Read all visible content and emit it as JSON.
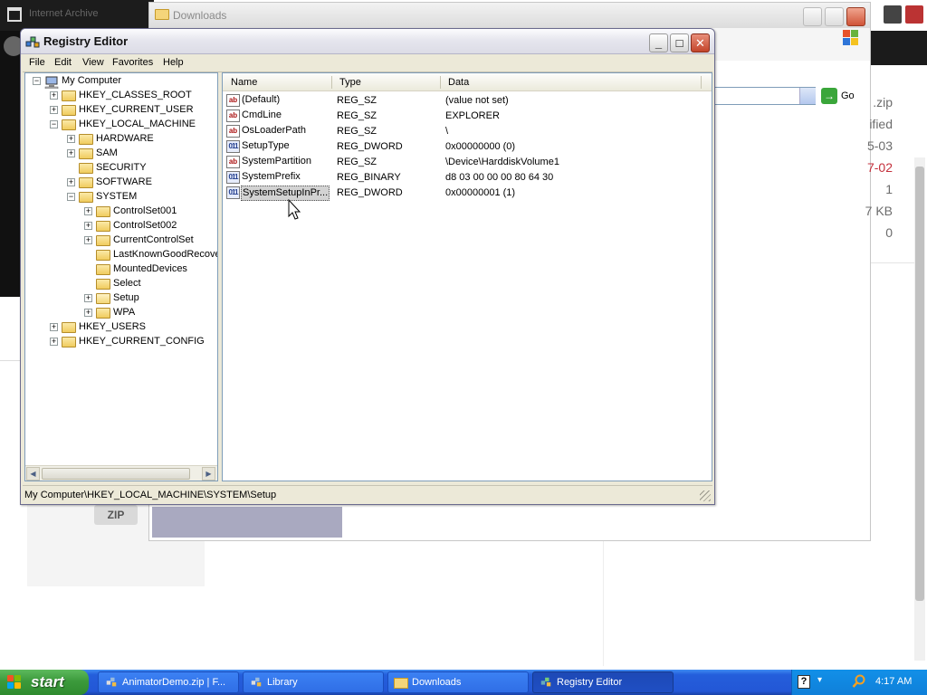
{
  "background": {
    "browser_title": "Internet Archive",
    "downloads_window_title": "Downloads",
    "go_label": "Go",
    "zip_label": "ZIP",
    "right_partial": [
      ".zip",
      "ified",
      "5-03",
      "7-02",
      "1",
      "7 KB",
      "0"
    ]
  },
  "regedit": {
    "title": "Registry Editor",
    "menu": [
      "File",
      "Edit",
      "View",
      "Favorites",
      "Help"
    ],
    "tree": [
      {
        "label": "My Computer",
        "level": 0,
        "expander": "-",
        "icon": "computer"
      },
      {
        "label": "HKEY_CLASSES_ROOT",
        "level": 1,
        "expander": "+",
        "icon": "folder"
      },
      {
        "label": "HKEY_CURRENT_USER",
        "level": 1,
        "expander": "+",
        "icon": "folder"
      },
      {
        "label": "HKEY_LOCAL_MACHINE",
        "level": 1,
        "expander": "-",
        "icon": "folder"
      },
      {
        "label": "HARDWARE",
        "level": 2,
        "expander": "+",
        "icon": "folder"
      },
      {
        "label": "SAM",
        "level": 2,
        "expander": "+",
        "icon": "folder"
      },
      {
        "label": "SECURITY",
        "level": 2,
        "expander": "",
        "icon": "folder"
      },
      {
        "label": "SOFTWARE",
        "level": 2,
        "expander": "+",
        "icon": "folder"
      },
      {
        "label": "SYSTEM",
        "level": 2,
        "expander": "-",
        "icon": "folder"
      },
      {
        "label": "ControlSet001",
        "level": 3,
        "expander": "+",
        "icon": "folder"
      },
      {
        "label": "ControlSet002",
        "level": 3,
        "expander": "+",
        "icon": "folder"
      },
      {
        "label": "CurrentControlSet",
        "level": 3,
        "expander": "+",
        "icon": "folder"
      },
      {
        "label": "LastKnownGoodRecove",
        "level": 3,
        "expander": "",
        "icon": "folder"
      },
      {
        "label": "MountedDevices",
        "level": 3,
        "expander": "",
        "icon": "folder"
      },
      {
        "label": "Select",
        "level": 3,
        "expander": "",
        "icon": "folder"
      },
      {
        "label": "Setup",
        "level": 3,
        "expander": "+",
        "icon": "folder-open"
      },
      {
        "label": "WPA",
        "level": 3,
        "expander": "+",
        "icon": "folder"
      },
      {
        "label": "HKEY_USERS",
        "level": 1,
        "expander": "+",
        "icon": "folder"
      },
      {
        "label": "HKEY_CURRENT_CONFIG",
        "level": 1,
        "expander": "+",
        "icon": "folder"
      }
    ],
    "columns": [
      "Name",
      "Type",
      "Data"
    ],
    "values": [
      {
        "name": "(Default)",
        "type": "REG_SZ",
        "data": "(value not set)",
        "icon": "string-value-icon"
      },
      {
        "name": "CmdLine",
        "type": "REG_SZ",
        "data": "EXPLORER",
        "icon": "string-value-icon"
      },
      {
        "name": "OsLoaderPath",
        "type": "REG_SZ",
        "data": "\\",
        "icon": "string-value-icon"
      },
      {
        "name": "SetupType",
        "type": "REG_DWORD",
        "data": "0x00000000 (0)",
        "icon": "binary-value-icon"
      },
      {
        "name": "SystemPartition",
        "type": "REG_SZ",
        "data": "\\Device\\HarddiskVolume1",
        "icon": "string-value-icon"
      },
      {
        "name": "SystemPrefix",
        "type": "REG_BINARY",
        "data": "d8 03 00 00 00 80 64 30",
        "icon": "binary-value-icon"
      },
      {
        "name": "SystemSetupInPr...",
        "type": "REG_DWORD",
        "data": "0x00000001 (1)",
        "icon": "binary-value-icon",
        "selected": true
      }
    ],
    "status": "My Computer\\HKEY_LOCAL_MACHINE\\SYSTEM\\Setup"
  },
  "taskbar": {
    "start_label": "start",
    "tasks": [
      {
        "label": "AnimatorDemo.zip | F...",
        "active": false
      },
      {
        "label": "Library",
        "active": false
      },
      {
        "label": "Downloads",
        "active": false
      },
      {
        "label": "Registry Editor",
        "active": true
      }
    ],
    "clock": "4:17 AM"
  }
}
